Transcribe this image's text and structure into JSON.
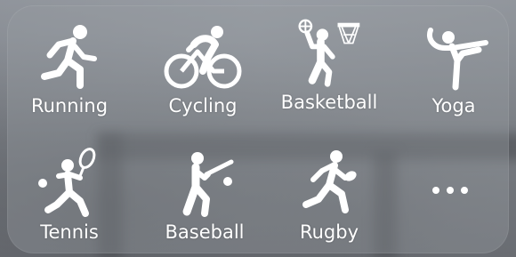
{
  "activities": [
    {
      "label": "Running",
      "icon": "running-icon"
    },
    {
      "label": "Cycling",
      "icon": "cycling-icon"
    },
    {
      "label": "Basketball",
      "icon": "basketball-icon"
    },
    {
      "label": "Yoga",
      "icon": "yoga-icon"
    },
    {
      "label": "Tennis",
      "icon": "tennis-icon"
    },
    {
      "label": "Baseball",
      "icon": "baseball-icon"
    },
    {
      "label": "Rugby",
      "icon": "rugby-icon"
    }
  ],
  "more": {
    "icon": "more-icon"
  },
  "colors": {
    "foreground": "#ffffff",
    "panel": "#969aa0"
  }
}
